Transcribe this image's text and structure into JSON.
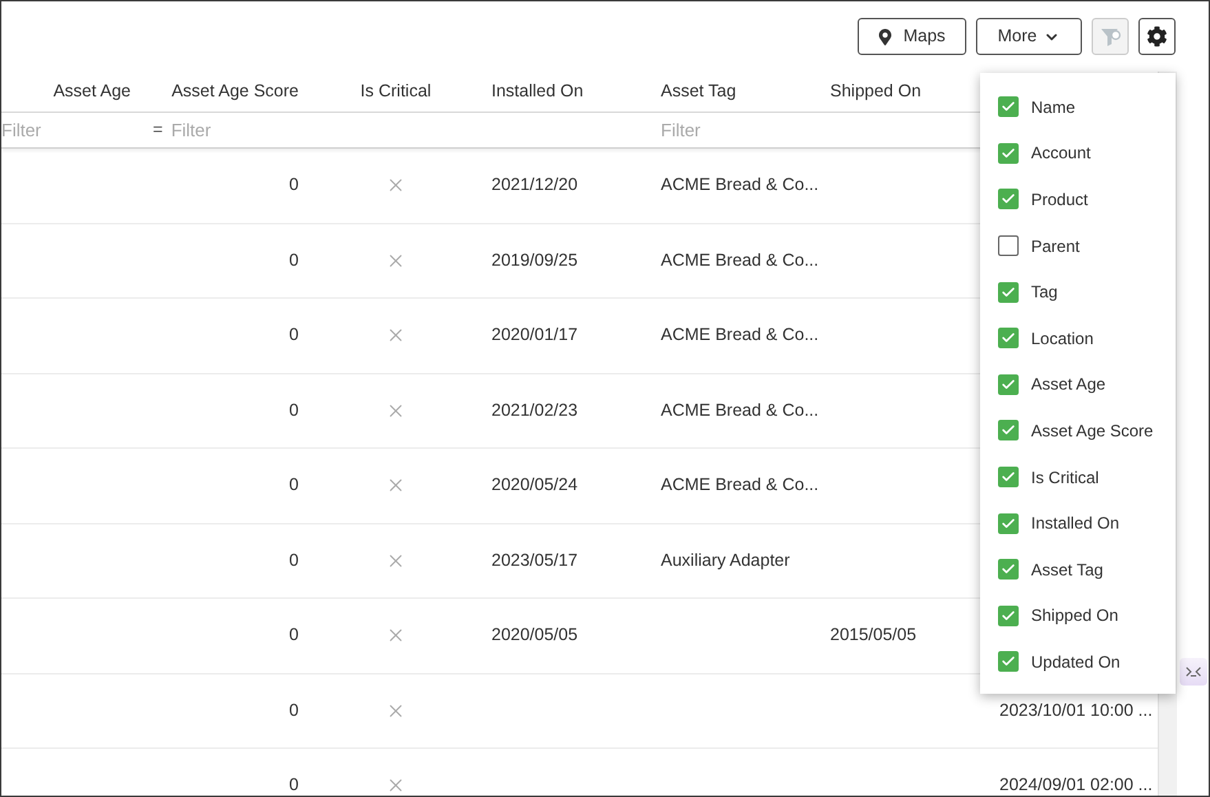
{
  "toolbar": {
    "maps_button": "Maps",
    "more_button": "More",
    "clear_filter_disabled": true
  },
  "columns": [
    {
      "header": "Asset Age",
      "filter_placeholder": "Filter"
    },
    {
      "header": "Asset Age Score",
      "filter_operator": "=",
      "filter_placeholder": "Filter"
    },
    {
      "header": "Is Critical"
    },
    {
      "header": "Installed On"
    },
    {
      "header": "Asset Tag",
      "filter_placeholder": "Filter"
    },
    {
      "header": "Shipped On"
    }
  ],
  "rows": [
    {
      "asset_age_score": "0",
      "is_critical": false,
      "installed_on": "2021/12/20",
      "asset_tag": "ACME Bread & Co..."
    },
    {
      "asset_age_score": "0",
      "is_critical": false,
      "installed_on": "2019/09/25",
      "asset_tag": "ACME Bread & Co..."
    },
    {
      "asset_age_score": "0",
      "is_critical": false,
      "installed_on": "2020/01/17",
      "asset_tag": "ACME Bread & Co..."
    },
    {
      "asset_age_score": "0",
      "is_critical": false,
      "installed_on": "2021/02/23",
      "asset_tag": "ACME Bread & Co..."
    },
    {
      "asset_age_score": "0",
      "is_critical": false,
      "installed_on": "2020/05/24",
      "asset_tag": "ACME Bread & Co..."
    },
    {
      "asset_age_score": "0",
      "is_critical": false,
      "installed_on": "2023/05/17",
      "asset_tag": "Auxiliary Adapter"
    },
    {
      "asset_age_score": "0",
      "is_critical": false,
      "installed_on": "2020/05/05",
      "shipped_on": "2015/05/05"
    },
    {
      "asset_age_score": "0",
      "is_critical": false,
      "updated_on": "2023/10/01 10:00 ..."
    },
    {
      "asset_age_score": "0",
      "is_critical": false,
      "updated_on": "2024/09/01 02:00 ..."
    }
  ],
  "column_menu": [
    {
      "label": "Name",
      "checked": true
    },
    {
      "label": "Account",
      "checked": true
    },
    {
      "label": "Product",
      "checked": true
    },
    {
      "label": "Parent",
      "checked": false
    },
    {
      "label": "Tag",
      "checked": true
    },
    {
      "label": "Location",
      "checked": true
    },
    {
      "label": "Asset Age",
      "checked": true
    },
    {
      "label": "Asset Age Score",
      "checked": true
    },
    {
      "label": "Is Critical",
      "checked": true
    },
    {
      "label": "Installed On",
      "checked": true
    },
    {
      "label": "Asset Tag",
      "checked": true
    },
    {
      "label": "Shipped On",
      "checked": true
    },
    {
      "label": "Updated On",
      "checked": true
    }
  ]
}
